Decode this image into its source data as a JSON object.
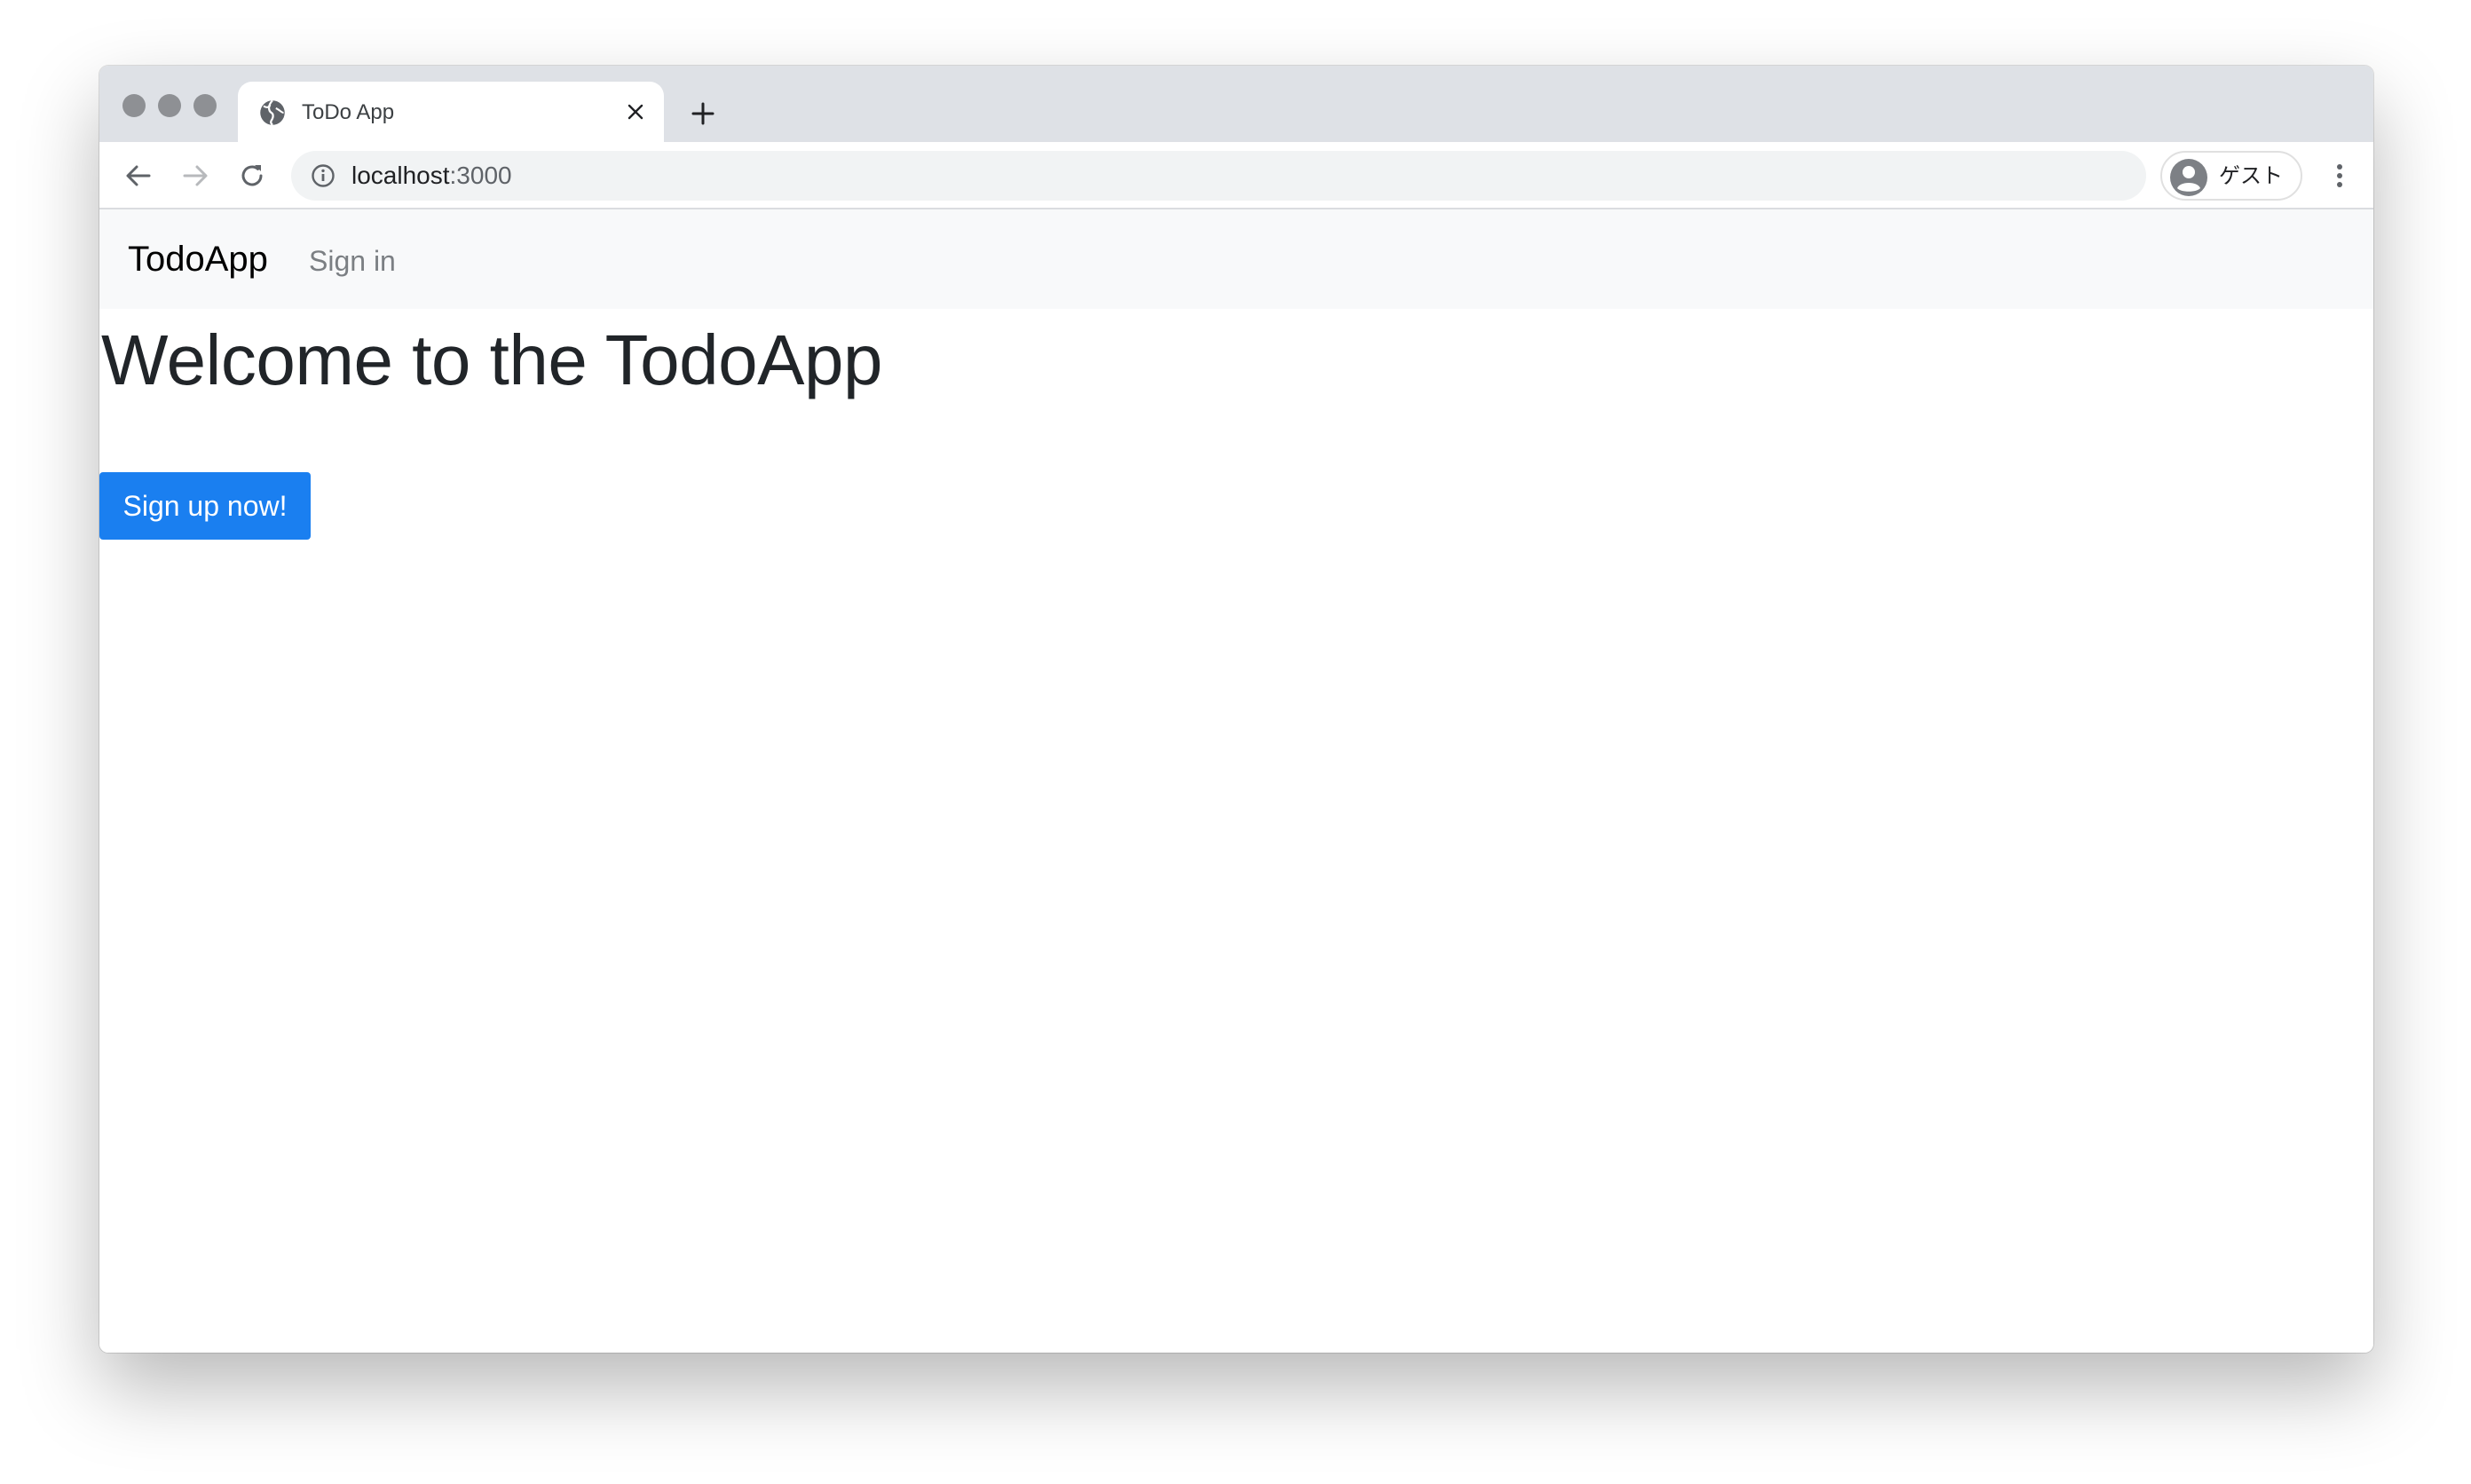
{
  "browser": {
    "tab": {
      "title": "ToDo App"
    },
    "address_bar": {
      "host": "localhost",
      "port": ":3000"
    },
    "profile": {
      "name": "ゲスト"
    },
    "icons": {
      "tab_favicon": "globe-icon",
      "tab_close": "close-icon",
      "new_tab": "plus-icon",
      "back": "arrow-left-icon",
      "forward": "arrow-right-icon",
      "reload": "reload-icon",
      "site_info": "info-icon",
      "profile_avatar": "user-avatar-icon",
      "menu": "more-vertical-icon"
    }
  },
  "page": {
    "navbar": {
      "brand": "TodoApp",
      "links": [
        {
          "label": "Sign in"
        }
      ]
    },
    "heading": "Welcome to the TodoApp",
    "signup_button": "Sign up now!",
    "colors": {
      "primary": "#1a7ff0",
      "navbar_bg": "#f8f9fa",
      "heading": "#212529"
    }
  }
}
